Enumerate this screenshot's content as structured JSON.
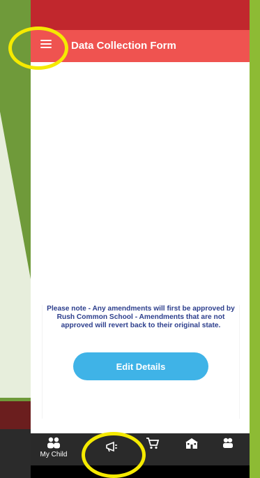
{
  "colors": {
    "status_bar": "#c1272d",
    "app_bar": "#ef5350",
    "accent_button": "#3fb3e7",
    "note_text": "#2c3e8c",
    "tab_bar": "#2a2a2a",
    "annotation": "#f5ea00",
    "slide_green": "#8dbb34"
  },
  "header": {
    "menu_icon": "hamburger-menu-icon",
    "title": "Data Collection Form"
  },
  "notice": {
    "text": "Please note - Any amendments will first be approved by Rush Common School - Amendments that are not approved will revert back to their original state."
  },
  "actions": {
    "edit_label": "Edit Details"
  },
  "tabs": [
    {
      "icon": "people-icon",
      "label": "My Child"
    },
    {
      "icon": "megaphone-icon",
      "label": ""
    },
    {
      "icon": "cart-icon",
      "label": ""
    },
    {
      "icon": "school-icon",
      "label": ""
    },
    {
      "icon": "contact-icon",
      "label": ""
    }
  ]
}
